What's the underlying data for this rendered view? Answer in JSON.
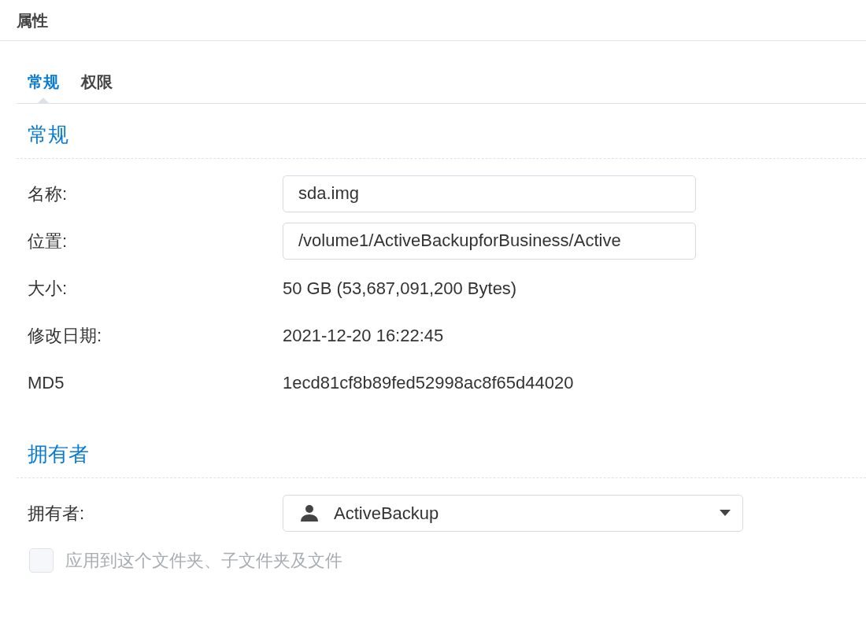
{
  "window": {
    "title": "属性"
  },
  "tabs": [
    {
      "label": "常规",
      "selected": true
    },
    {
      "label": "权限",
      "selected": false
    }
  ],
  "sections": [
    {
      "title": "常规",
      "rows": [
        {
          "kind": "input",
          "label": "名称:",
          "value": "sda.img"
        },
        {
          "kind": "input",
          "label": "位置:",
          "value": "/volume1/ActiveBackupforBusiness/Active"
        },
        {
          "kind": "text",
          "label": "大小:",
          "value": "50 GB (53,687,091,200 Bytes)"
        },
        {
          "kind": "text",
          "label": "修改日期:",
          "value": "2021-12-20 16:22:45"
        },
        {
          "kind": "text",
          "label": "MD5",
          "value": "1ecd81cf8b89fed52998ac8f65d44020"
        }
      ]
    },
    {
      "title": "拥有者",
      "rows": [
        {
          "kind": "select",
          "label": "拥有者:",
          "value": "ActiveBackup"
        },
        {
          "kind": "checkbox",
          "label": "应用到这个文件夹、子文件夹及文件",
          "checked": false,
          "disabled": true
        }
      ]
    }
  ]
}
